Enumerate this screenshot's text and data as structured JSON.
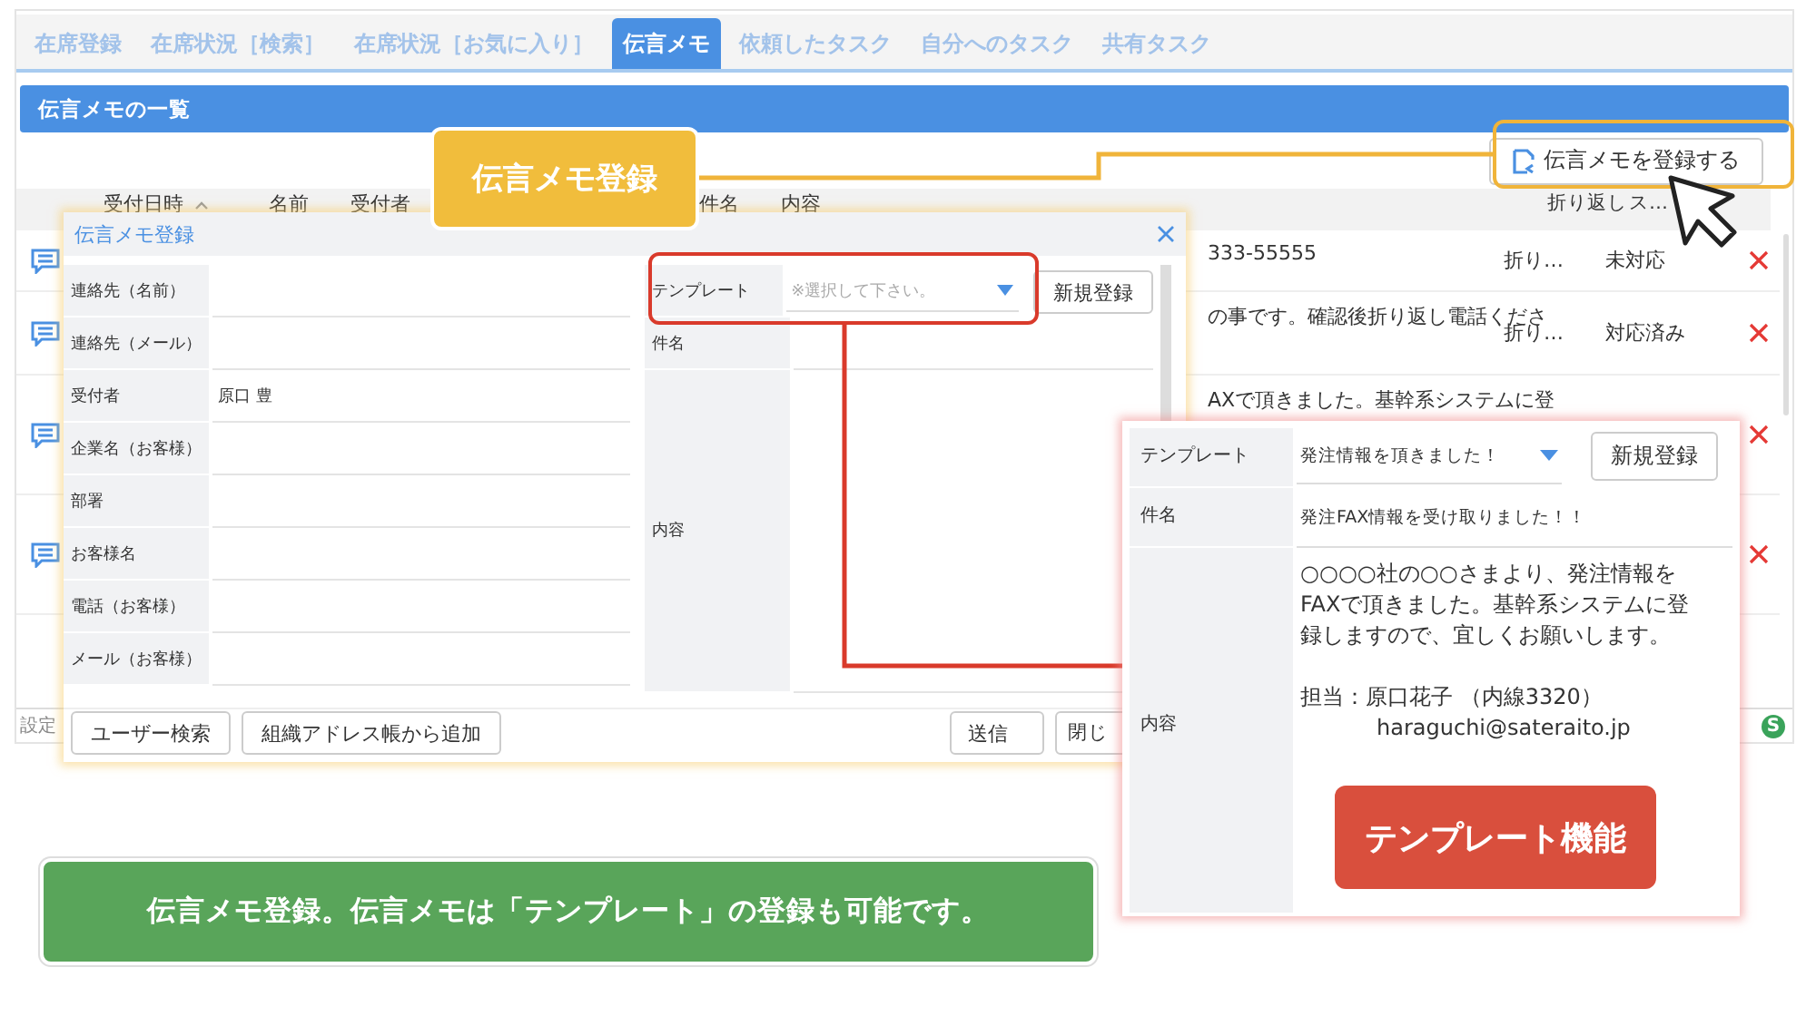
{
  "tabs": [
    {
      "label": "在席登録",
      "selected": false
    },
    {
      "label": "在席状況［検索］",
      "selected": false
    },
    {
      "label": "在席状況［お気に入り］",
      "selected": false
    },
    {
      "label": "伝言メモ",
      "selected": true
    },
    {
      "label": "依頼したタスク",
      "selected": false
    },
    {
      "label": "自分へのタスク",
      "selected": false
    },
    {
      "label": "共有タスク",
      "selected": false
    }
  ],
  "list_header": "伝言メモの一覧",
  "register_button": "伝言メモを登録する",
  "table": {
    "columns": [
      "受付日時",
      "名前",
      "受付者",
      "件名",
      "内容",
      "折り返し",
      "ス…"
    ],
    "rows": [
      {
        "content": "333-55555",
        "callback": "折り…",
        "status": "未対応",
        "deletable": true
      },
      {
        "content": "の事です。確認後折り返し電話くださ",
        "callback": "折り…",
        "status": "対応済み",
        "deletable": true
      },
      {
        "content": "AXで頂きました。基幹系システムに登",
        "deletable": true
      },
      {
        "deletable": true
      }
    ]
  },
  "status_bar": {
    "label": "設定",
    "badge": "S"
  },
  "callout_register": "伝言メモ登録",
  "dialog": {
    "title": "伝言メモ登録",
    "fields": [
      {
        "label": "連絡先（名前）"
      },
      {
        "label": "連絡先（メール）"
      },
      {
        "label": "受付者",
        "value": "原口 豊"
      },
      {
        "label": "企業名（お客様）"
      },
      {
        "label": "部署"
      },
      {
        "label": "お客様名"
      },
      {
        "label": "電話（お客様）"
      },
      {
        "label": "メール（お客様）"
      }
    ],
    "template_label": "テンプレート",
    "template_placeholder": "※選択して下さい。",
    "new_button": "新規登録",
    "subject_label": "件名",
    "content_label": "内容",
    "buttons_left": [
      "ユーザー検索",
      "組織アドレス帳から追加"
    ],
    "buttons_right": [
      "送信",
      "閉じ"
    ]
  },
  "template_dialog": {
    "template_label": "テンプレート",
    "template_value": "発注情報を頂きました！",
    "new_button": "新規登録",
    "subject_label": "件名",
    "subject_value": "発注FAX情報を受け取りました！！",
    "content_label": "内容",
    "content_lines": [
      "○○○○社の○○さまより、発注情報をFAXで頂きました。基幹系システムに登録しますので、宜しくお願いします。",
      "担当：原口花子 （内線3320）",
      "haraguchi@sateraito.jp"
    ]
  },
  "callout_template": "テンプレート機能",
  "banner": "伝言メモ登録。伝言メモは「テンプレート」の登録も可能です。"
}
